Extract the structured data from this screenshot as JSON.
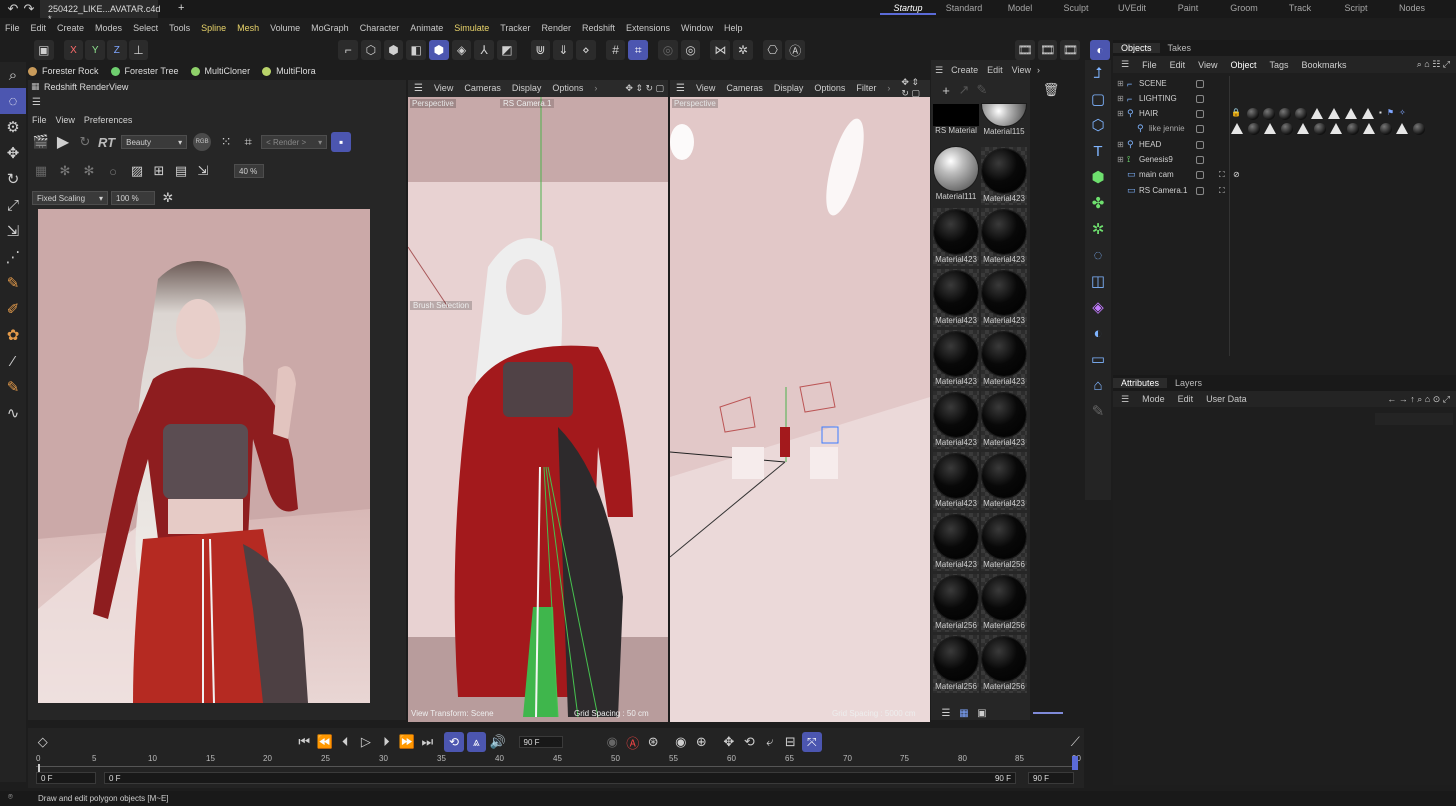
{
  "window": {
    "doc_tab": "250422_LIKE...AVATAR.c4d *",
    "add_tab": "+"
  },
  "layouts": [
    "Startup",
    "Standard",
    "Model",
    "Sculpt",
    "UVEdit",
    "Paint",
    "Groom",
    "Track",
    "Script",
    "Nodes"
  ],
  "menubar": [
    "File",
    "Edit",
    "Create",
    "Modes",
    "Select",
    "Tools",
    "Spline",
    "Mesh",
    "Volume",
    "MoGraph",
    "Character",
    "Animate",
    "Simulate",
    "Tracker",
    "Render",
    "Redshift",
    "Extensions",
    "Window",
    "Help"
  ],
  "maintools": {
    "axes": [
      "X",
      "Y",
      "Z"
    ]
  },
  "plugins": [
    {
      "label": "Forester Rock",
      "color": "#c89a5a"
    },
    {
      "label": "Forester Tree",
      "color": "#6fcf6f"
    },
    {
      "label": "MultiCloner",
      "color": "#8fd16a"
    },
    {
      "label": "MultiFlora",
      "color": "#b9d36a"
    }
  ],
  "renderview": {
    "title": "Redshift RenderView",
    "menu": [
      "File",
      "View",
      "Preferences"
    ],
    "rt": "RT",
    "aov": "Beauty",
    "rgb": "RGB",
    "render_target": "< Render >",
    "zoom": "40 %",
    "scaling": "Fixed Scaling",
    "scale_pct": "100 %"
  },
  "viewport1": {
    "menu": [
      "View",
      "Cameras",
      "Display",
      "Options"
    ],
    "label": "Perspective",
    "camera": "RS Camera.1",
    "brush": "Brush Selection",
    "transform": "View Transform: Scene",
    "grid": "Grid Spacing : 50 cm"
  },
  "viewport2": {
    "menu": [
      "View",
      "Cameras",
      "Display",
      "Options",
      "Filter"
    ],
    "label": "Perspective",
    "grid": "Grid Spacing : 5000 cm"
  },
  "materials": {
    "menu": [
      "Create",
      "Edit",
      "View"
    ],
    "items": [
      "RS Material",
      "Material115",
      "Material111",
      "Material423",
      "Material423",
      "Material423",
      "Material423",
      "Material423",
      "Material423",
      "Material423",
      "Material423",
      "Material423",
      "Material423",
      "Material423",
      "Material423",
      "Material256",
      "Material256",
      "Material256",
      "Material256",
      "Material256"
    ]
  },
  "objects": {
    "tabs": [
      "Objects",
      "Takes"
    ],
    "menu": [
      "File",
      "Edit",
      "View",
      "Object",
      "Tags",
      "Bookmarks"
    ],
    "rows": [
      "SCENE",
      "LIGHTING",
      "HAIR",
      "like jennie",
      "HEAD",
      "Genesis9",
      "main cam",
      "RS Camera.1"
    ]
  },
  "attributes": {
    "tabs": [
      "Attributes",
      "Layers"
    ],
    "menu": [
      "Mode",
      "Edit",
      "User Data"
    ]
  },
  "timeline": {
    "ticks": [
      "0",
      "5",
      "10",
      "15",
      "20",
      "25",
      "30",
      "35",
      "40",
      "45",
      "50",
      "55",
      "60",
      "65",
      "70",
      "75",
      "80",
      "85",
      "90"
    ],
    "current_frame": "90 F",
    "start": "0 F",
    "preview_start": "0 F",
    "preview_end": "90 F",
    "end": "90 F"
  },
  "status": "Draw and edit polygon objects [M~E]"
}
